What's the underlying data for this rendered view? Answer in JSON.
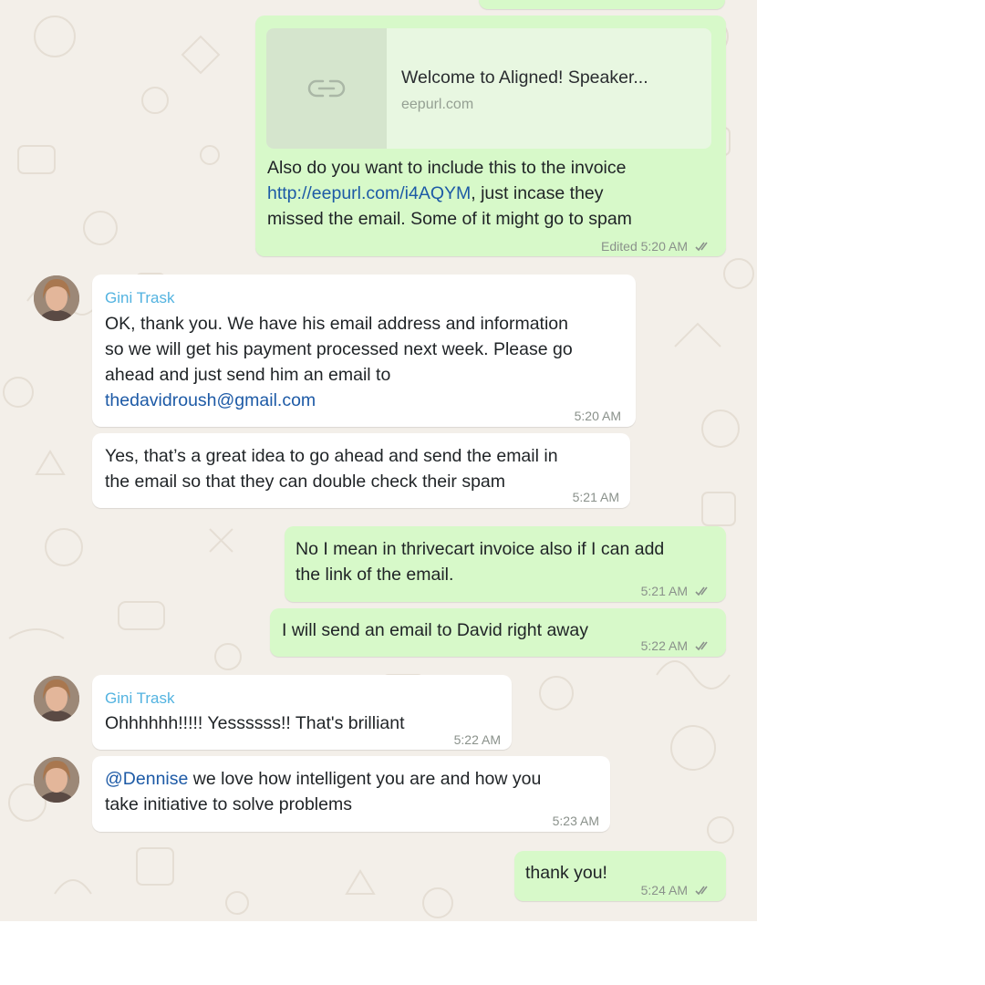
{
  "messages": {
    "m1": {
      "preview_title": "Welcome to Aligned! Speaker...",
      "preview_domain": "eepurl.com",
      "line1": "Also do you want to include this to the invoice",
      "line2_link": "http://eepurl.com/i4AQYM",
      "line2_rest": ", just incase they",
      "line3": "missed the email. Some of it might go to spam",
      "time": "Edited 5:20 AM"
    },
    "m2": {
      "sender": "Gini Trask",
      "line1": "OK, thank you. We have his email address and information",
      "line2": "so we will get his payment processed next week. Please go",
      "line3": "ahead and just send him an email to",
      "line4_link": "thedavidroush@gmail.com",
      "time": "5:20 AM"
    },
    "m3": {
      "line1": "Yes, that’s a great idea to go ahead and send the email in",
      "line2": "the email so that they can double check their spam",
      "time": "5:21 AM"
    },
    "m4": {
      "line1": "No I mean in thrivecart invoice also if I can add",
      "line2": "the link of the email.",
      "time": "5:21 AM"
    },
    "m5": {
      "line1": "I will send an email to David right away",
      "time": "5:22 AM"
    },
    "m6": {
      "sender": "Gini Trask",
      "line1": "Ohhhhhh!!!!! Yessssss!! That's brilliant",
      "time": "5:22 AM"
    },
    "m7": {
      "mention": "@Dennise",
      "line1_rest": " we love how intelligent you are and how you",
      "line2": "take initiative to solve problems",
      "time": "5:23 AM"
    },
    "m8": {
      "line1": "thank you!",
      "time": "5:24 AM"
    }
  },
  "icons": {
    "read_receipt": "double-check-icon",
    "link": "link-icon"
  },
  "colors": {
    "outgoing_bubble": "#d7f9c9",
    "incoming_bubble": "#ffffff",
    "sender_name": "#53b3e0",
    "link": "#1d5aa6",
    "chat_background": "#f3efe9"
  }
}
